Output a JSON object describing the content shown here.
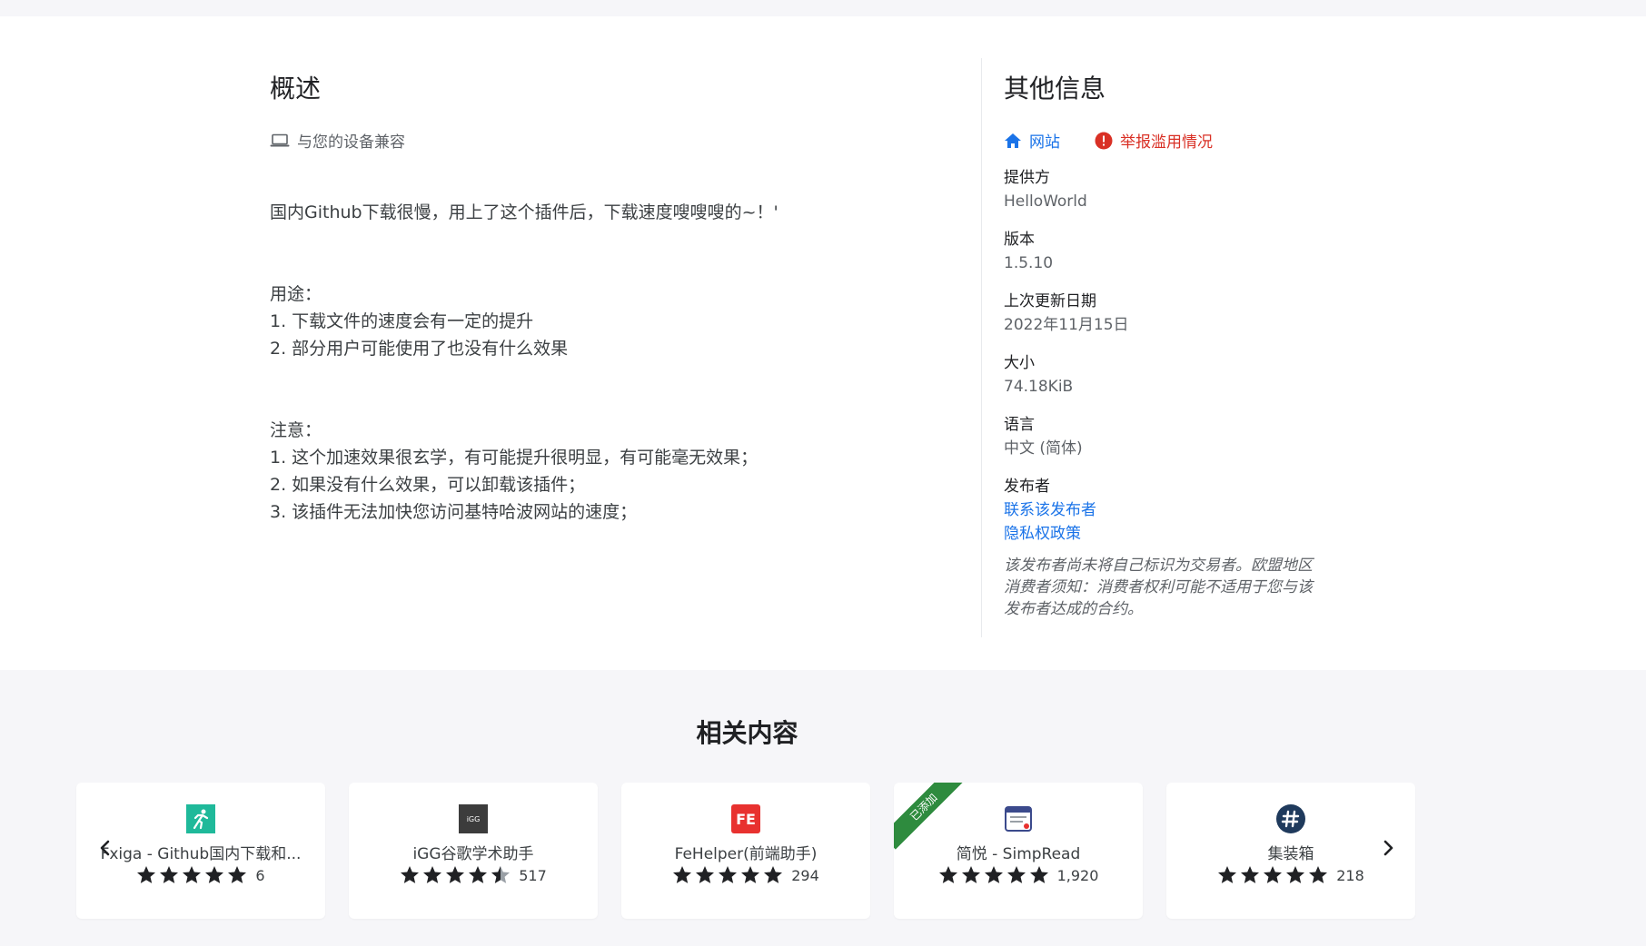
{
  "overview": {
    "title": "概述",
    "compat": "与您的设备兼容",
    "paragraphs": [
      "国内Github下载很慢，用上了这个插件后，下载速度嗖嗖嗖的~！'",
      "用途：\n1. 下载文件的速度会有一定的提升\n2. 部分用户可能使用了也没有什么效果",
      "注意：\n1. 这个加速效果很玄学，有可能提升很明显，有可能毫无效果；\n2. 如果没有什么效果，可以卸载该插件；\n3. 该插件无法加快您访问基特哈波网站的速度；"
    ]
  },
  "other": {
    "title": "其他信息",
    "website": "网站",
    "report": "举报滥用情况",
    "provider_label": "提供方",
    "provider": "HelloWorld",
    "version_label": "版本",
    "version": "1.5.10",
    "updated_label": "上次更新日期",
    "updated": "2022年11月15日",
    "size_label": "大小",
    "size": "74.18KiB",
    "language_label": "语言",
    "language": "中文 (简体)",
    "publisher_label": "发布者",
    "contact": "联系该发布者",
    "privacy": "隐私权政策",
    "trader_note": "该发布者尚未将自己标识为交易者。欧盟地区消费者须知：消费者权利可能不适用于您与该发布者达成的合约。"
  },
  "related": {
    "title": "相关内容",
    "cards": [
      {
        "name": "Fxiga - Github国内下载和...",
        "rating": 5,
        "count": "6",
        "icon": "runner-icon",
        "icon_color": "#1fb99a"
      },
      {
        "name": "iGG谷歌学术助手",
        "rating": 4.5,
        "count": "517",
        "icon": "igg-icon",
        "icon_color": "#3c3c3c"
      },
      {
        "name": "FeHelper(前端助手)",
        "rating": 5,
        "count": "294",
        "icon": "fe-icon",
        "icon_color": "#e8312f"
      },
      {
        "name": "简悦 - SimpRead",
        "rating": 5,
        "count": "1,920",
        "icon": "simpread-icon",
        "icon_color": "#3b4a8c",
        "badge": "已添加"
      },
      {
        "name": "集装箱",
        "rating": 5,
        "count": "218",
        "icon": "hash-icon",
        "icon_color": "#1f3a5c"
      }
    ]
  },
  "colors": {
    "link": "#1a73e8",
    "report": "#d93025",
    "ribbon": "#2e8b3e"
  }
}
